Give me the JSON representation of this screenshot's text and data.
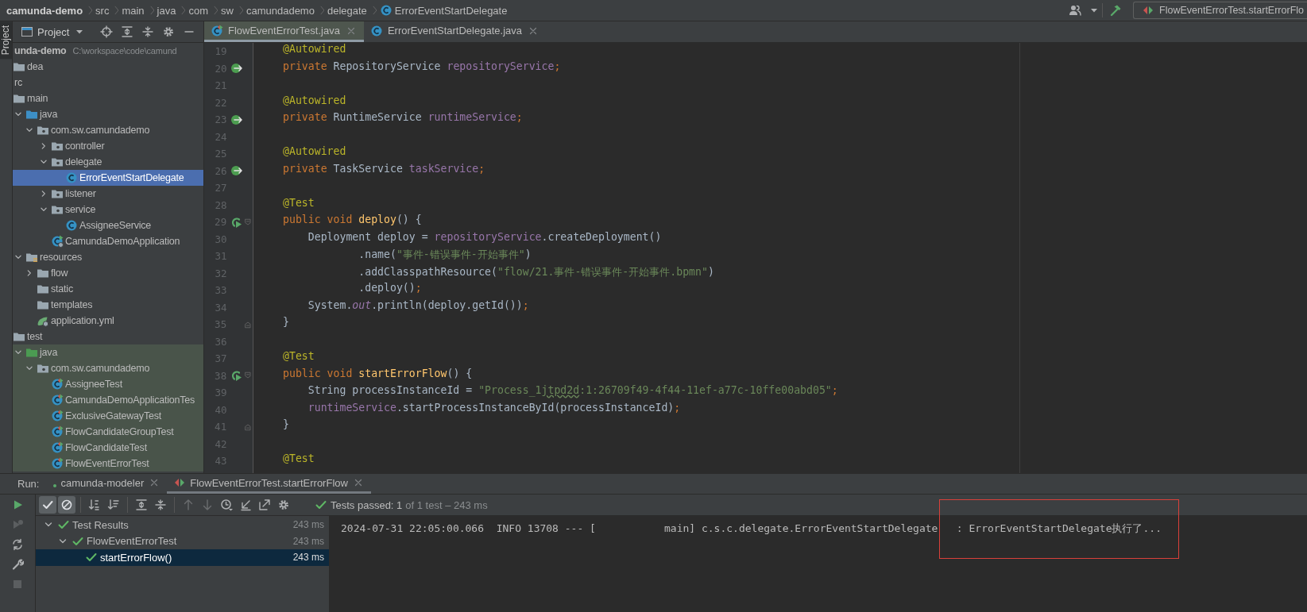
{
  "breadcrumbs": [
    {
      "label": "camunda-demo",
      "kind": "project"
    },
    {
      "label": "src",
      "kind": "folder"
    },
    {
      "label": "main",
      "kind": "folder"
    },
    {
      "label": "java",
      "kind": "folder"
    },
    {
      "label": "com",
      "kind": "folder"
    },
    {
      "label": "sw",
      "kind": "folder"
    },
    {
      "label": "camundademo",
      "kind": "folder"
    },
    {
      "label": "delegate",
      "kind": "folder"
    },
    {
      "label": "ErrorEventStartDelegate",
      "kind": "class"
    }
  ],
  "toolbar": {
    "actions": [
      {
        "kind": "user"
      },
      {
        "kind": "build"
      }
    ],
    "run_config": "FlowEventErrorTest.startErrorFlo"
  },
  "side_stripe": {
    "label": "Project",
    "selected": true
  },
  "project_panel": {
    "title": "Project",
    "actions": [
      {
        "kind": "locate"
      },
      {
        "kind": "expand-all"
      },
      {
        "kind": "collapse-all"
      },
      {
        "kind": "settings"
      },
      {
        "kind": "hide"
      }
    ],
    "tree": [
      {
        "label": "unda-demo",
        "location": "C:\\workspace\\code\\camund",
        "selected": false,
        "children": [
          {
            "label": "dea",
            "kind": "folder",
            "selected": false
          },
          {
            "label": "rc",
            "selected": false,
            "children": [
              {
                "label": "main",
                "kind": "folder",
                "selected": false,
                "children": [
                  {
                    "label": "java",
                    "kind": "src-folder",
                    "expanded": true,
                    "selected": false,
                    "children": [
                      {
                        "label": "com.sw.camundademo",
                        "kind": "package",
                        "expanded": true,
                        "selected": false,
                        "children": [
                          {
                            "label": "controller",
                            "kind": "package",
                            "expanded": false,
                            "selected": false
                          },
                          {
                            "label": "delegate",
                            "kind": "package",
                            "expanded": true,
                            "selected": false,
                            "children": [
                              {
                                "label": "ErrorEventStartDelegate",
                                "kind": "class",
                                "selected": true
                              }
                            ]
                          },
                          {
                            "label": "listener",
                            "kind": "package",
                            "expanded": false,
                            "selected": false
                          },
                          {
                            "label": "service",
                            "kind": "package",
                            "expanded": true,
                            "selected": false,
                            "children": [
                              {
                                "label": "AssigneeService",
                                "kind": "class",
                                "selected": false
                              }
                            ]
                          },
                          {
                            "label": "CamundaDemoApplication",
                            "kind": "spring-class",
                            "selected": false
                          }
                        ]
                      }
                    ]
                  },
                  {
                    "label": "resources",
                    "kind": "resources",
                    "expanded": true,
                    "selected": false,
                    "children": [
                      {
                        "label": "flow",
                        "kind": "folder",
                        "expanded": false,
                        "selected": false
                      },
                      {
                        "label": "static",
                        "kind": "folder",
                        "selected": false
                      },
                      {
                        "label": "templates",
                        "kind": "folder",
                        "selected": false
                      },
                      {
                        "label": "application.yml",
                        "kind": "yml",
                        "selected": false
                      }
                    ]
                  }
                ]
              },
              {
                "label": "test",
                "kind": "folder",
                "selected": false,
                "children": [
                  {
                    "label": "java",
                    "kind": "test-folder",
                    "expanded": true,
                    "test_source": true,
                    "selected": false,
                    "children": [
                      {
                        "label": "com.sw.camundademo",
                        "kind": "package",
                        "expanded": true,
                        "test_source": true,
                        "selected": false,
                        "children": [
                          {
                            "label": "AssigneeTest",
                            "kind": "test-class",
                            "test_source": true,
                            "selected": false
                          },
                          {
                            "label": "CamundaDemoApplicationTes",
                            "kind": "test-class",
                            "test_source": true,
                            "selected": false
                          },
                          {
                            "label": "ExclusiveGatewayTest",
                            "kind": "test-class",
                            "test_source": true,
                            "selected": false
                          },
                          {
                            "label": "FlowCandidateGroupTest",
                            "kind": "test-class",
                            "test_source": true,
                            "selected": false
                          },
                          {
                            "label": "FlowCandidateTest",
                            "kind": "test-class",
                            "test_source": true,
                            "selected": false
                          },
                          {
                            "label": "FlowEventErrorTest",
                            "kind": "test-class",
                            "test_source": true,
                            "selected": false
                          }
                        ]
                      }
                    ]
                  }
                ]
              }
            ]
          }
        ]
      }
    ]
  },
  "editor": {
    "tabs": [
      {
        "label": "FlowEventErrorTest.java",
        "kind": "test-class",
        "selected": true
      },
      {
        "label": "ErrorEventStartDelegate.java",
        "kind": "class",
        "selected": false
      }
    ],
    "lines": [
      {
        "number": "19",
        "tokens": [
          {
            "text": "@Autowired",
            "kind": "ann"
          }
        ]
      },
      {
        "number": "20",
        "marker": {
          "kind": "bean"
        },
        "tokens": [
          {
            "text": "private ",
            "kind": "kw"
          },
          {
            "text": "RepositoryService ",
            "kind": "plain"
          },
          {
            "text": "repositoryService",
            "kind": "field"
          },
          {
            "text": ";",
            "kind": "kw"
          }
        ]
      },
      {
        "number": "21"
      },
      {
        "number": "22",
        "tokens": [
          {
            "text": "@Autowired",
            "kind": "ann"
          }
        ]
      },
      {
        "number": "23",
        "marker": {
          "kind": "bean"
        },
        "tokens": [
          {
            "text": "private ",
            "kind": "kw"
          },
          {
            "text": "RuntimeService ",
            "kind": "plain"
          },
          {
            "text": "runtimeService",
            "kind": "field"
          },
          {
            "text": ";",
            "kind": "kw"
          }
        ]
      },
      {
        "number": "24"
      },
      {
        "number": "25",
        "tokens": [
          {
            "text": "@Autowired",
            "kind": "ann"
          }
        ]
      },
      {
        "number": "26",
        "marker": {
          "kind": "bean"
        },
        "tokens": [
          {
            "text": "private ",
            "kind": "kw"
          },
          {
            "text": "TaskService ",
            "kind": "plain"
          },
          {
            "text": "taskService",
            "kind": "field"
          },
          {
            "text": ";",
            "kind": "kw"
          }
        ]
      },
      {
        "number": "27"
      },
      {
        "number": "28",
        "tokens": [
          {
            "text": "@Test",
            "kind": "ann"
          }
        ]
      },
      {
        "number": "29",
        "marker": {
          "kind": "run"
        },
        "fold": {
          "kind": "start"
        },
        "tokens": [
          {
            "text": "public void ",
            "kind": "kw"
          },
          {
            "text": "deploy",
            "kind": "method"
          },
          {
            "text": "() {",
            "kind": "plain"
          }
        ]
      },
      {
        "number": "30",
        "tokens": [
          {
            "text": "    Deployment deploy = ",
            "kind": "plain"
          },
          {
            "text": "repositoryService",
            "kind": "field"
          },
          {
            "text": ".createDeployment()",
            "kind": "plain"
          }
        ]
      },
      {
        "number": "31",
        "tokens": [
          {
            "text": "            .name(",
            "kind": "plain"
          },
          {
            "text": "\"事件-错误事件-开始事件\"",
            "kind": "str"
          },
          {
            "text": ")",
            "kind": "plain"
          }
        ]
      },
      {
        "number": "32",
        "tokens": [
          {
            "text": "            .addClasspathResource(",
            "kind": "plain"
          },
          {
            "text": "\"flow/21.事件-错误事件-开始事件.bpmn\"",
            "kind": "str"
          },
          {
            "text": ")",
            "kind": "plain"
          }
        ]
      },
      {
        "number": "33",
        "tokens": [
          {
            "text": "            .deploy()",
            "kind": "plain"
          },
          {
            "text": ";",
            "kind": "kw"
          }
        ]
      },
      {
        "number": "34",
        "tokens": [
          {
            "text": "    System.",
            "kind": "plain"
          },
          {
            "text": "out",
            "kind": "static"
          },
          {
            "text": ".println(deploy.getId())",
            "kind": "plain"
          },
          {
            "text": ";",
            "kind": "kw"
          }
        ]
      },
      {
        "number": "35",
        "fold": {
          "kind": "end"
        },
        "tokens": [
          {
            "text": "}",
            "kind": "plain"
          }
        ]
      },
      {
        "number": "36"
      },
      {
        "number": "37",
        "tokens": [
          {
            "text": "@Test",
            "kind": "ann"
          }
        ]
      },
      {
        "number": "38",
        "marker": {
          "kind": "run"
        },
        "fold": {
          "kind": "start"
        },
        "tokens": [
          {
            "text": "public void ",
            "kind": "kw"
          },
          {
            "text": "startErrorFlow",
            "kind": "method"
          },
          {
            "text": "() {",
            "kind": "plain"
          }
        ]
      },
      {
        "number": "39",
        "tokens": [
          {
            "text": "    String processInstanceId = ",
            "kind": "plain"
          },
          {
            "text": "\"Process_1",
            "kind": "str"
          },
          {
            "text": "jtpd2d",
            "kind": "str",
            "typo": true
          },
          {
            "text": ":1:26709f49-4f44-11ef-a77c-10ffe00abd05\"",
            "kind": "str"
          },
          {
            "text": ";",
            "kind": "kw"
          }
        ]
      },
      {
        "number": "40",
        "tokens": [
          {
            "text": "    runtimeService",
            "kind": "field"
          },
          {
            "text": ".startProcessInstanceById(processInstanceId)",
            "kind": "plain"
          },
          {
            "text": ";",
            "kind": "kw"
          }
        ]
      },
      {
        "number": "41",
        "fold": {
          "kind": "end"
        },
        "tokens": [
          {
            "text": "}",
            "kind": "plain"
          }
        ]
      },
      {
        "number": "42"
      },
      {
        "number": "43",
        "tokens": [
          {
            "text": "@Test",
            "kind": "ann"
          }
        ]
      }
    ]
  },
  "run": {
    "label": "Run:",
    "tabs": [
      {
        "label": "camunda-modeler",
        "kind": "spring",
        "selected": false
      },
      {
        "label": "FlowEventErrorTest.startErrorFlow",
        "kind": "test",
        "selected": true
      }
    ],
    "side_actions": [
      {
        "kind": "rerun",
        "disabled": false
      },
      {
        "kind": "rerun-failed",
        "disabled": true
      },
      {
        "kind": "auto-test",
        "disabled": false
      },
      {
        "kind": "wrench",
        "disabled": false
      },
      {
        "kind": "stop",
        "disabled": true
      }
    ],
    "toolbar": [
      [
        {
          "kind": "show-passed",
          "on": true,
          "disabled": false
        },
        {
          "kind": "show-ignored",
          "on": true,
          "disabled": false
        }
      ],
      [
        {
          "kind": "sort-alpha",
          "on": false,
          "disabled": false
        },
        {
          "kind": "sort-duration",
          "on": false,
          "disabled": false
        }
      ],
      [
        {
          "kind": "expand-all",
          "on": false,
          "disabled": false
        },
        {
          "kind": "collapse-all",
          "on": false,
          "disabled": false
        }
      ],
      [
        {
          "kind": "previous",
          "on": false,
          "disabled": true
        },
        {
          "kind": "next",
          "on": false,
          "disabled": true
        },
        {
          "kind": "history",
          "on": false,
          "disabled": false
        },
        {
          "kind": "import",
          "on": false,
          "disabled": false
        },
        {
          "kind": "export",
          "on": false,
          "disabled": false
        },
        {
          "kind": "settings",
          "on": false,
          "disabled": false
        }
      ]
    ],
    "summary": "Tests passed: 1",
    "detail": "of 1 test – 243 ms",
    "results": [
      {
        "label": "Test Results",
        "time": "243 ms",
        "passed": true,
        "expanded": true,
        "selected": false,
        "children": [
          {
            "label": "FlowEventErrorTest",
            "time": "243 ms",
            "passed": true,
            "expanded": true,
            "selected": false,
            "children": [
              {
                "label": "startErrorFlow()",
                "time": "243 ms",
                "passed": true,
                "selected": true
              }
            ]
          }
        ]
      }
    ],
    "console": [
      {
        "text": "2024-07-31 22:05:00.066  INFO 13708 --- [           main] c.s.c.delegate.ErrorEventStartDelegate"
      },
      {
        "text": ": ErrorEventStartDelegate执行了...",
        "highlighted": true
      }
    ]
  }
}
